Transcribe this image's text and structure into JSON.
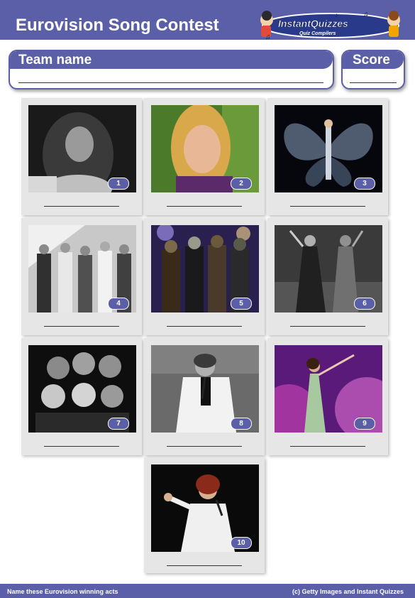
{
  "header": {
    "title": "Eurovision Song Contest"
  },
  "logo": {
    "brand": "InstantQuizzes",
    "tagline": "Quiz Compilers",
    "colors": {
      "outline": "#1e2a6a",
      "accent": "#f2a400"
    }
  },
  "team": {
    "label": "Team name"
  },
  "score": {
    "label": "Score"
  },
  "theme": {
    "primary": "#5a5fa8",
    "card": "#e6e6e6"
  },
  "cards": [
    {
      "number": "1",
      "photo": "black-and-white portrait of a woman with long wavy hair",
      "icon": "photo-icon"
    },
    {
      "number": "2",
      "photo": "colour portrait of a blonde woman",
      "icon": "photo-icon"
    },
    {
      "number": "3",
      "photo": "singer on stage with a glowing butterfly-wing backdrop",
      "icon": "photo-icon"
    },
    {
      "number": "4",
      "photo": "black-and-white photo of a four-piece pop group on stage",
      "icon": "photo-icon"
    },
    {
      "number": "5",
      "photo": "costumed monster rock band on stage",
      "icon": "photo-icon"
    },
    {
      "number": "6",
      "photo": "two women performing in sequinned outfits",
      "icon": "photo-icon"
    },
    {
      "number": "7",
      "photo": "black-and-white group portrait of a band",
      "icon": "photo-icon"
    },
    {
      "number": "8",
      "photo": "black-and-white photo of a male singer in a white suit",
      "icon": "photo-icon"
    },
    {
      "number": "9",
      "photo": "female singer in a green gown on a purple lit stage",
      "icon": "photo-icon"
    },
    {
      "number": "10",
      "photo": "female singer in white with arm raised, red hair",
      "icon": "photo-icon"
    }
  ],
  "footer": {
    "left": "Name these Eurovision winning acts",
    "right": "(c) Getty Images and Instant Quizzes"
  }
}
